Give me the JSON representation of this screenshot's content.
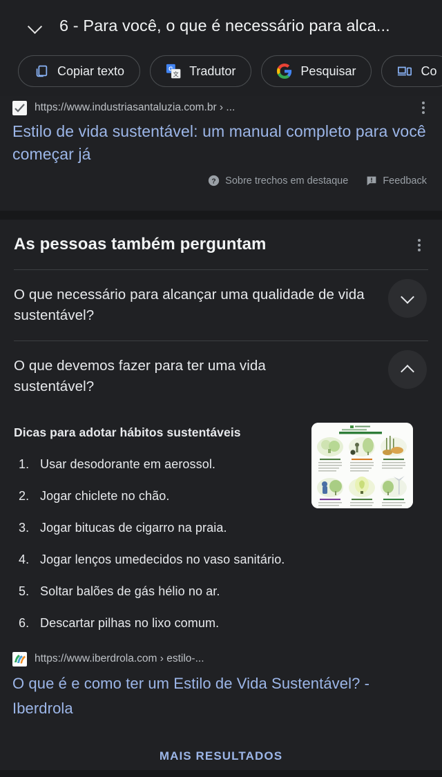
{
  "theme": {
    "page_bg": "#202124",
    "header_bg": "#1f2023",
    "link_blue": "#9cb6e8",
    "text_primary": "#e8eaed",
    "text_secondary": "#9aa0a6",
    "divider": "#3c4043"
  },
  "header": {
    "collapse_icon": "chevron-down-icon",
    "title": "6 - Para você, o que é necessário para alca...",
    "chips": [
      {
        "icon": "copy-text-icon",
        "label": "Copiar texto"
      },
      {
        "icon": "google-translate-icon",
        "label": "Tradutor"
      },
      {
        "icon": "google-g-icon",
        "label": "Pesquisar"
      },
      {
        "icon": "cast-to-device-icon",
        "label": "Co"
      }
    ]
  },
  "featured_result": {
    "favicon": "industriasantaluzia-favicon",
    "url": "https://www.industriasantaluzia.com.br › ...",
    "title": "Estilo de vida sustentável: um manual completo para você começar já",
    "kebab_icon": "more-options-icon",
    "footer": [
      {
        "icon": "help-circle-icon",
        "label": "Sobre trechos em destaque"
      },
      {
        "icon": "feedback-icon",
        "label": "Feedback"
      }
    ]
  },
  "people_also_ask": {
    "heading": "As pessoas também perguntam",
    "kebab_icon": "more-options-icon",
    "questions": [
      {
        "text": "O que necessário para alcançar uma qualidade de vida sustentável?",
        "expanded": false,
        "toggle_icon": "chevron-down-icon"
      },
      {
        "text": "O que devemos fazer para ter uma vida sustentável?",
        "expanded": true,
        "toggle_icon": "chevron-up-icon"
      }
    ],
    "answer": {
      "lead": "Dicas para adotar hábitos sustentáveis",
      "items": [
        "Usar desodorante em aerossol.",
        "Jogar chiclete no chão.",
        "Jogar bitucas de cigarro na praia.",
        "Jogar lenços umedecidos no vaso sanitário.",
        "Soltar balões de gás hélio no ar.",
        "Descartar pilhas no lixo comum."
      ],
      "thumbnail": "sustainable-habits-infographic"
    },
    "source": {
      "favicon": "iberdrola-favicon",
      "url": "https://www.iberdrola.com › estilo-...",
      "title": "O que é e como ter um Estilo de Vida Sustentável? - Iberdrola"
    }
  },
  "footer": {
    "more_results_label": "MAIS RESULTADOS"
  }
}
